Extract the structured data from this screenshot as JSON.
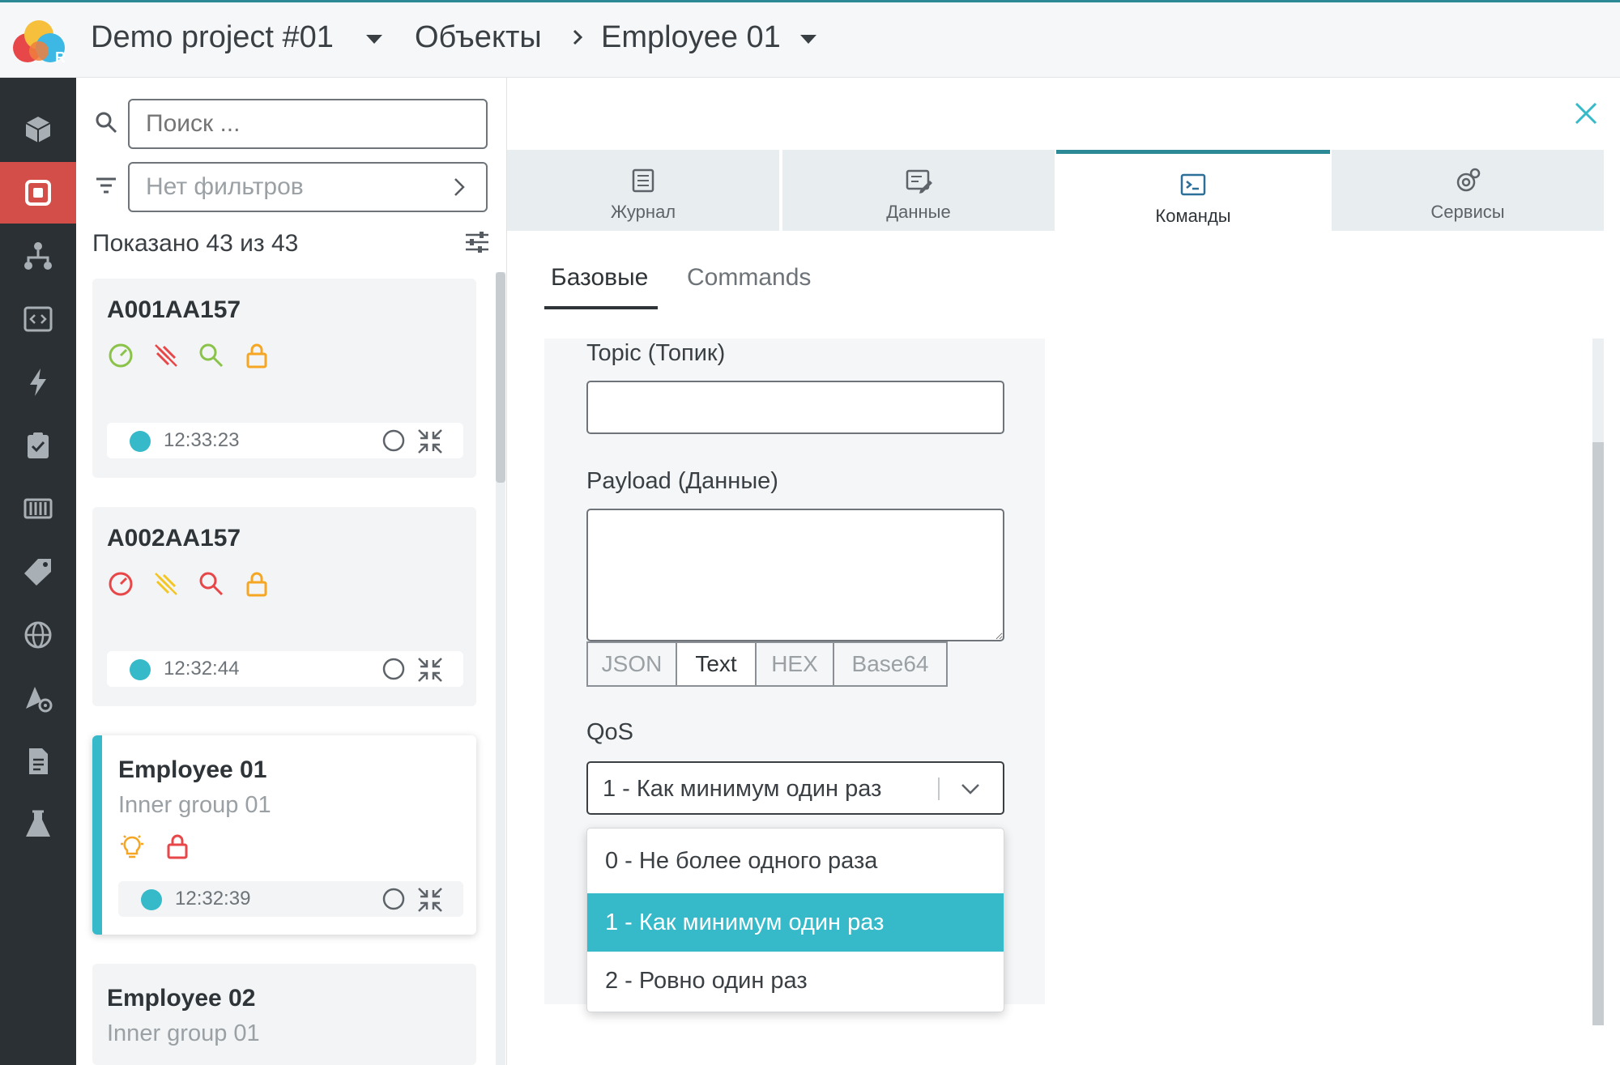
{
  "header": {
    "project": "Demo project #01",
    "section": "Объекты",
    "object": "Employee 01"
  },
  "sidebar_rail": {
    "items": [
      "cube-icon",
      "device-icon",
      "hierarchy-icon",
      "code-icon",
      "lightning-icon",
      "clipboard-check-icon",
      "barcode-icon",
      "tag-icon",
      "globe-icon",
      "geofence-settings-icon",
      "document-icon",
      "flask-icon"
    ],
    "active_index": 1,
    "active_color": "#d34e49"
  },
  "list": {
    "search_placeholder": "Поиск ...",
    "filter_label": "Нет фильтров",
    "shown_text": "Показано 43 из 43",
    "cards": [
      {
        "title": "A001AA157",
        "subtitle": "",
        "time": "12:33:23",
        "icons": [
          "speedometer-icon-green",
          "satellite-off-icon-red",
          "key-search-icon-green",
          "lock-icon-orange"
        ]
      },
      {
        "title": "A002AA157",
        "subtitle": "",
        "time": "12:32:44",
        "icons": [
          "speedometer-icon-red",
          "satellite-off-icon-yellow",
          "key-search-icon-red",
          "lock-icon-orange"
        ]
      },
      {
        "title": "Employee 01",
        "subtitle": "Inner group 01",
        "time": "12:32:39",
        "icons": [
          "bulb-icon-orange",
          "lock-icon-red"
        ],
        "selected": true
      },
      {
        "title": "Employee 02",
        "subtitle": "Inner group 01",
        "time": "",
        "icons": []
      }
    ]
  },
  "tabs": [
    {
      "label": "Журнал",
      "icon": "list-icon"
    },
    {
      "label": "Данные",
      "icon": "data-edit-icon"
    },
    {
      "label": "Команды",
      "icon": "terminal-icon",
      "active": true
    },
    {
      "label": "Сервисы",
      "icon": "gear-cog-icon"
    }
  ],
  "subtabs": [
    {
      "label": "Базовые",
      "active": true
    },
    {
      "label": "Commands",
      "active": false
    }
  ],
  "form": {
    "topic_label": "Topic (Топик)",
    "topic_value": "",
    "payload_label": "Payload (Данные)",
    "payload_value": "",
    "formats": [
      "JSON",
      "Text",
      "HEX",
      "Base64"
    ],
    "format_selected": "Text",
    "qos_label": "QoS",
    "qos_value": "1 - Как минимум один раз",
    "qos_options": [
      "0 - Не более одного раза",
      "1 - Как минимум один раз",
      "2 - Ровно один раз"
    ]
  },
  "colors": {
    "accent": "#36b9c8",
    "tab_active_border": "#2c8a97",
    "rail_bg": "#2b3034"
  }
}
